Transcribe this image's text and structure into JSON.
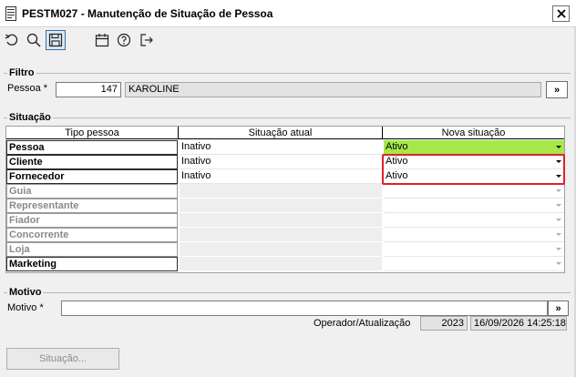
{
  "window": {
    "title": "PESTM027 - Manutenção de Situação de Pessoa",
    "close_label": "✕"
  },
  "toolbar": {
    "buttons": [
      {
        "icon": "undo-icon",
        "active": false
      },
      {
        "icon": "search-icon",
        "active": false
      },
      {
        "icon": "save-icon",
        "active": true
      },
      {
        "icon": "calendar-icon",
        "active": false
      },
      {
        "icon": "help-icon",
        "active": false
      },
      {
        "icon": "exit-icon",
        "active": false
      }
    ]
  },
  "filtro": {
    "legend": "Filtro",
    "pessoa_label": "Pessoa *",
    "pessoa_code": "147",
    "pessoa_name": "KAROLINE",
    "lookup_label": "»"
  },
  "situacao": {
    "legend": "Situação",
    "columns": [
      "Tipo pessoa",
      "Situação atual",
      "Nova situação"
    ],
    "rows": [
      {
        "tipo": "Pessoa",
        "atual": "Inativo",
        "nova": "Ativo",
        "enabled": true,
        "green": true
      },
      {
        "tipo": "Cliente",
        "atual": "Inativo",
        "nova": "Ativo",
        "enabled": true,
        "green": false
      },
      {
        "tipo": "Fornecedor",
        "atual": "Inativo",
        "nova": "Ativo",
        "enabled": true,
        "green": false
      },
      {
        "tipo": "Guia",
        "atual": "",
        "nova": "",
        "enabled": false,
        "green": false
      },
      {
        "tipo": "Representante",
        "atual": "",
        "nova": "",
        "enabled": false,
        "green": false
      },
      {
        "tipo": "Fiador",
        "atual": "",
        "nova": "",
        "enabled": false,
        "green": false
      },
      {
        "tipo": "Concorrente",
        "atual": "",
        "nova": "",
        "enabled": false,
        "green": false
      },
      {
        "tipo": "Loja",
        "atual": "",
        "nova": "",
        "enabled": false,
        "green": false
      },
      {
        "tipo": "Marketing",
        "atual": "",
        "nova": "",
        "enabled": true,
        "green": false
      }
    ]
  },
  "motivo": {
    "legend": "Motivo",
    "motivo_label": "Motivo *",
    "motivo_value": "",
    "lookup_label": "»",
    "operador_label": "Operador/Atualização",
    "operador_code": "2023",
    "atualizacao": "16/09/2026 14:25:18"
  },
  "footer": {
    "situacao_button": "Situação..."
  },
  "colors": {
    "accent_green": "#a6e84a",
    "highlight_red": "#e0202a"
  }
}
